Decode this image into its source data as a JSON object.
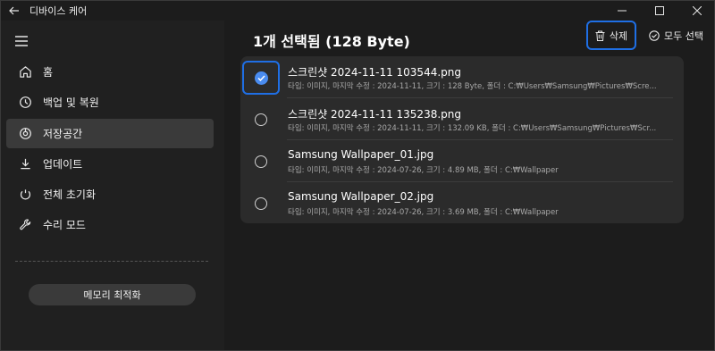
{
  "app": {
    "title": "디바이스 케어"
  },
  "sidebar": {
    "items": [
      {
        "label": "홈",
        "icon": "home-icon"
      },
      {
        "label": "백업 및 복원",
        "icon": "backup-icon"
      },
      {
        "label": "저장공간",
        "icon": "storage-icon",
        "active": true
      },
      {
        "label": "업데이트",
        "icon": "download-icon"
      },
      {
        "label": "전체 초기화",
        "icon": "reset-icon"
      },
      {
        "label": "수리 모드",
        "icon": "wrench-icon"
      }
    ],
    "optimize_label": "메모리 최적화"
  },
  "main": {
    "selection_title": "1개 선택됨 (128 Byte)",
    "delete_label": "삭제",
    "select_all_label": "모두 선택",
    "files": [
      {
        "name": "스크린샷 2024-11-11 103544.png",
        "meta": "타입: 이미지, 마지막 수정 : 2024-11-11, 크기 : 128 Byte, 폴더 : C:₩Users₩Samsung₩Pictures₩Scre...",
        "checked": true
      },
      {
        "name": "스크린샷 2024-11-11 135238.png",
        "meta": "타입: 이미지, 마지막 수정 : 2024-11-11, 크기 : 132.09 KB, 폴더 : C:₩Users₩Samsung₩Pictures₩Scr...",
        "checked": false
      },
      {
        "name": "Samsung Wallpaper_01.jpg",
        "meta": "타입: 이미지, 마지막 수정 : 2024-07-26, 크기 : 4.89 MB, 폴더 : C:₩Wallpaper",
        "checked": false
      },
      {
        "name": "Samsung Wallpaper_02.jpg",
        "meta": "타입: 이미지, 마지막 수정 : 2024-07-26, 크기 : 3.69 MB, 폴더 : C:₩Wallpaper",
        "checked": false
      }
    ]
  },
  "colors": {
    "accent": "#1f6fe5",
    "check_fill": "#4a8cf0",
    "background": "#1c1c1c",
    "sidebar": "#202020",
    "panel": "#2b2b2b"
  }
}
